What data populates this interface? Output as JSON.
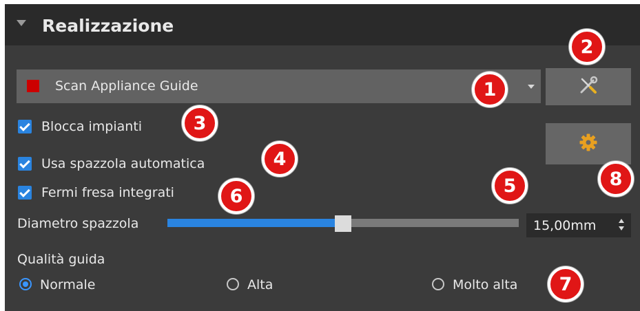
{
  "panel": {
    "title": "Realizzazione"
  },
  "dropdown": {
    "selected": "Scan Appliance Guide",
    "swatch_color": "#cc0000"
  },
  "buttons": {
    "tools_icon": "wrench-screwdriver-icon",
    "settings_icon": "gear-icon"
  },
  "checkboxes": [
    {
      "label": "Blocca impianti",
      "checked": true
    },
    {
      "label": "Usa spazzola automatica",
      "checked": true
    },
    {
      "label": "Fermi fresa integrati",
      "checked": true
    }
  ],
  "slider": {
    "label": "Diametro spazzola",
    "value": "15,00mm",
    "fill_fraction": 0.5
  },
  "quality": {
    "label": "Qualità guida",
    "options": [
      {
        "label": "Normale",
        "selected": true
      },
      {
        "label": "Alta",
        "selected": false
      },
      {
        "label": "Molto alta",
        "selected": false
      }
    ]
  },
  "markers": [
    "1",
    "2",
    "3",
    "4",
    "5",
    "6",
    "7",
    "8"
  ],
  "colors": {
    "accent": "#2a84e0",
    "marker": "#e01616",
    "panel_bg": "#3b3b3b",
    "header_bg": "#2a2a2a"
  }
}
